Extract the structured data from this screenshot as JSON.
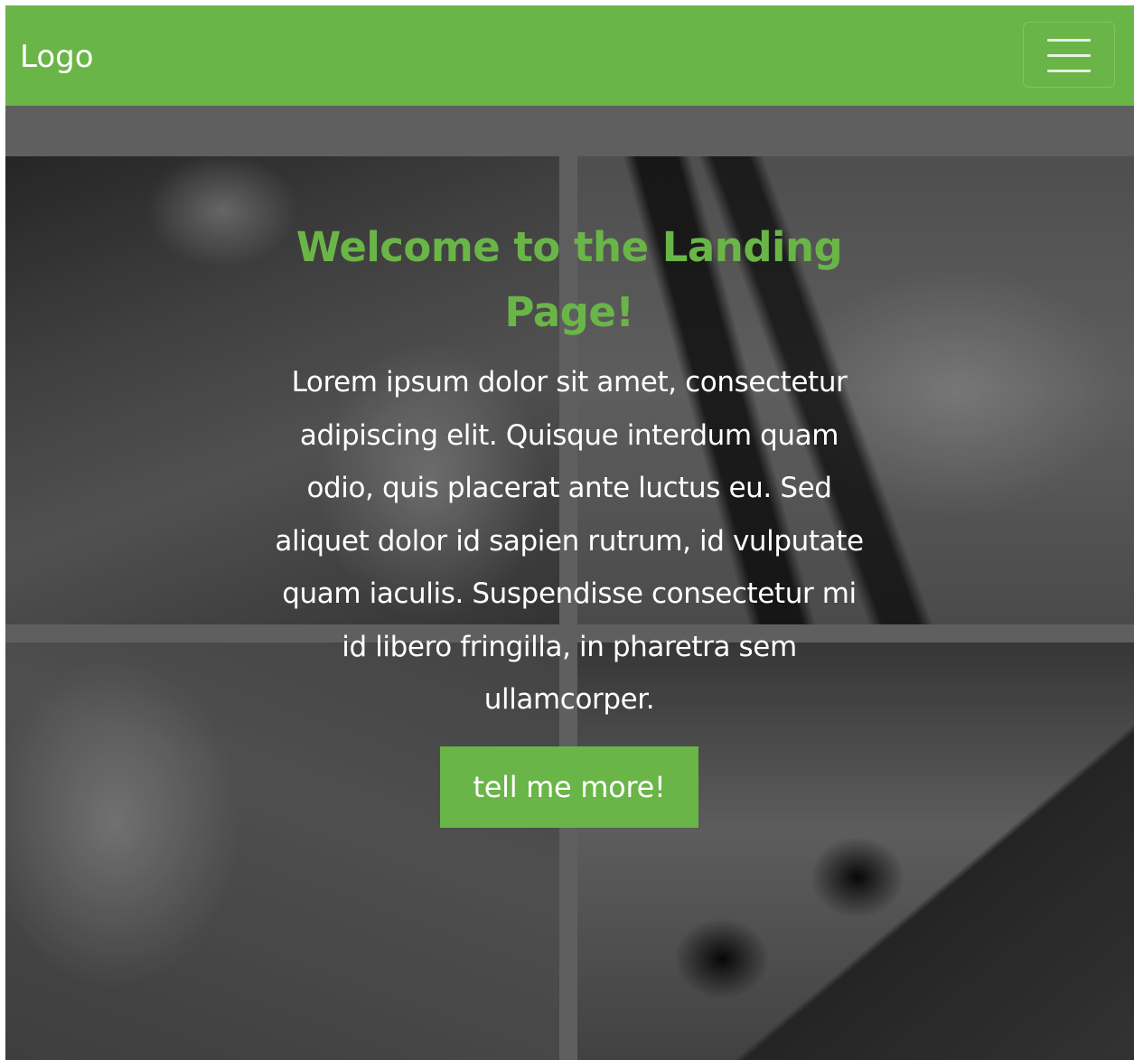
{
  "navbar": {
    "brand": "Logo",
    "toggler_icon": "hamburger-menu-icon"
  },
  "hero": {
    "title": "Welcome to the Landing Page!",
    "text": "Lorem ipsum dolor sit amet, consectetur adipiscing elit. Quisque interdum quam odio, quis placerat ante luctus eu. Sed aliquet dolor id sapien rutrum, id vulputate quam iaculis. Suspendisse consectetur mi id libero fringilla, in pharetra sem ullamcorper.",
    "button_label": "tell me more!"
  },
  "colors": {
    "accent": "#6ab547",
    "text_light": "#ffffff",
    "background_dark": "#5f5f5f"
  }
}
